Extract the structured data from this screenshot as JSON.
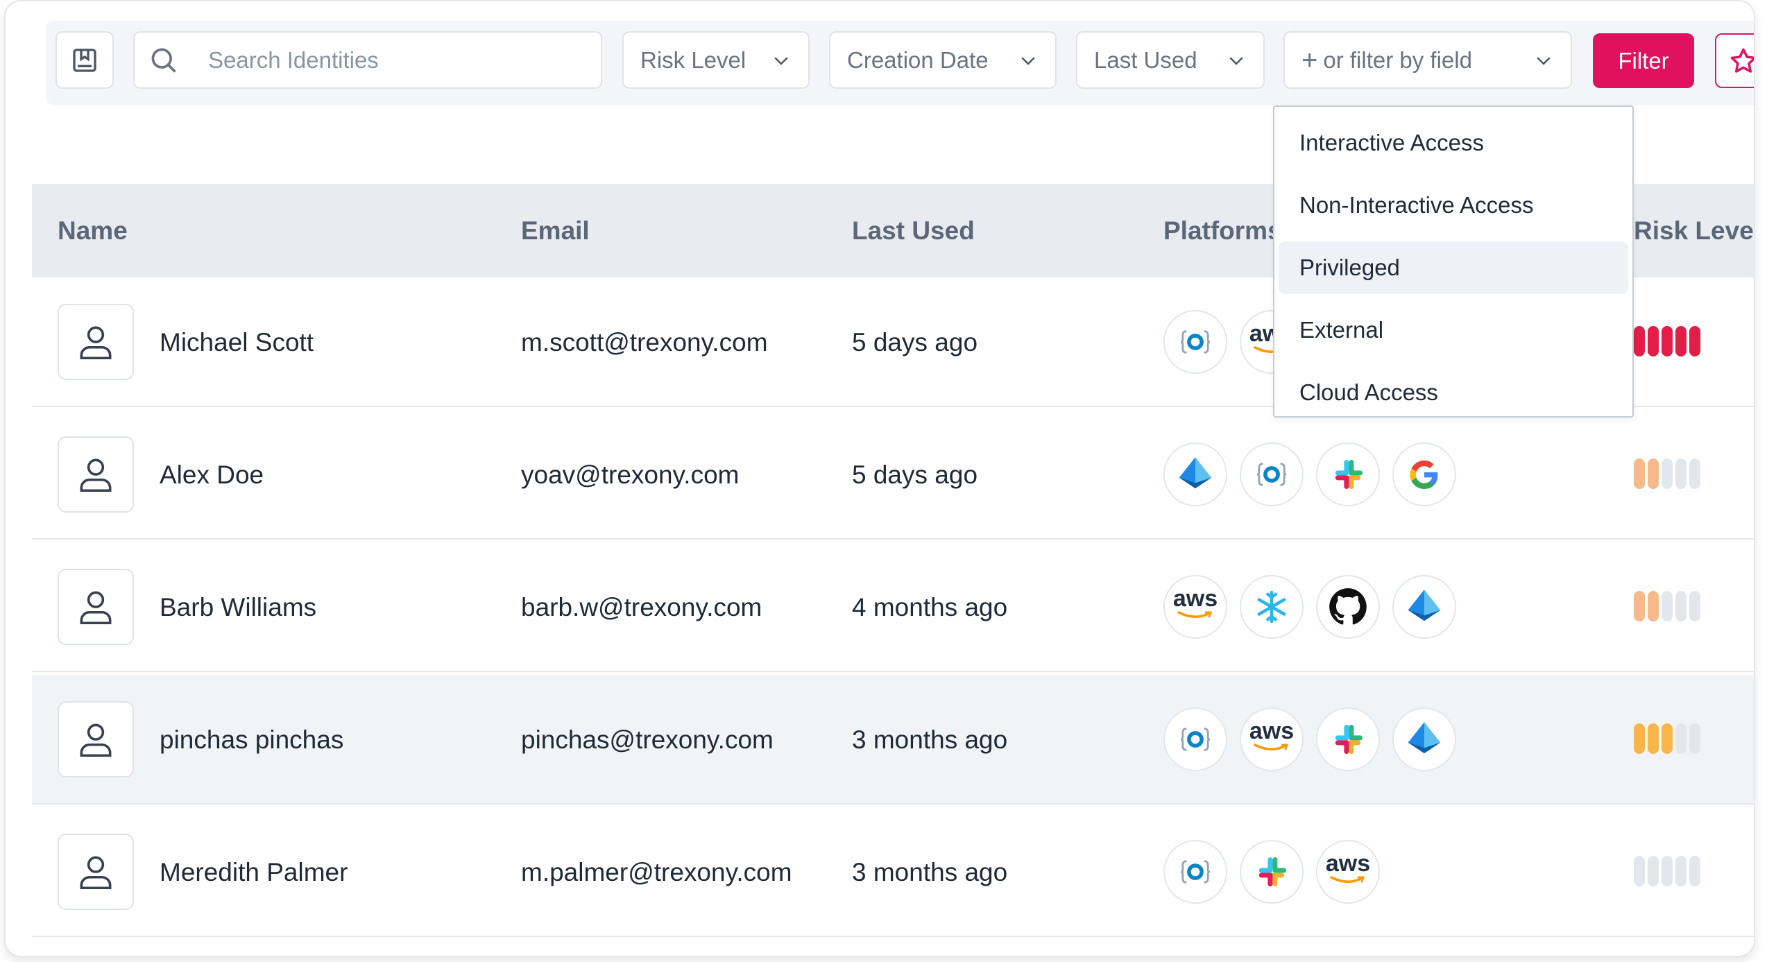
{
  "toolbar": {
    "search_placeholder": "Search Identities",
    "filters": {
      "risk_level": "Risk Level",
      "creation_date": "Creation Date",
      "last_used": "Last Used",
      "field": "or filter by field"
    },
    "filter_button": "Filter",
    "accent_color": "#e0115f"
  },
  "table": {
    "headers": {
      "name": "Name",
      "email": "Email",
      "last_used": "Last Used",
      "platforms": "Platforms",
      "risk_level": "Risk Level"
    },
    "rows": [
      {
        "name": "Michael Scott",
        "email": "m.scott@trexony.com",
        "last_used": "5 days ago",
        "platforms": [
          "sso-icon",
          "aws-icon"
        ],
        "risk": 5,
        "risk_color": "#e11d48"
      },
      {
        "name": "Alex Doe",
        "email": "yoav@trexony.com",
        "last_used": "5 days ago",
        "platforms": [
          "azure-ad-icon",
          "sso-icon",
          "slack-icon",
          "google-icon"
        ],
        "risk": 2,
        "risk_color": "#f6b98a"
      },
      {
        "name": "Barb Williams",
        "email": "barb.w@trexony.com",
        "last_used": "4 months ago",
        "platforms": [
          "aws-icon",
          "snowflake-icon",
          "github-icon",
          "azure-ad-icon"
        ],
        "risk": 2,
        "risk_color": "#f6b98a"
      },
      {
        "name": "pinchas pinchas",
        "email": "pinchas@trexony.com",
        "last_used": "3 months ago",
        "platforms": [
          "sso-icon",
          "aws-icon",
          "slack-icon",
          "azure-ad-icon"
        ],
        "risk": 3,
        "risk_color": "#f7b54a"
      },
      {
        "name": "Meredith Palmer",
        "email": "m.palmer@trexony.com",
        "last_used": "3 months ago",
        "platforms": [
          "sso-icon",
          "slack-icon",
          "aws-icon"
        ],
        "risk": 0,
        "risk_color": "#e3e7ec"
      }
    ]
  },
  "field_menu": {
    "items": [
      "Interactive Access",
      "Non-Interactive Access",
      "Privileged",
      "External",
      "Cloud Access"
    ],
    "highlighted": "Privileged"
  },
  "aws_label": "aws"
}
